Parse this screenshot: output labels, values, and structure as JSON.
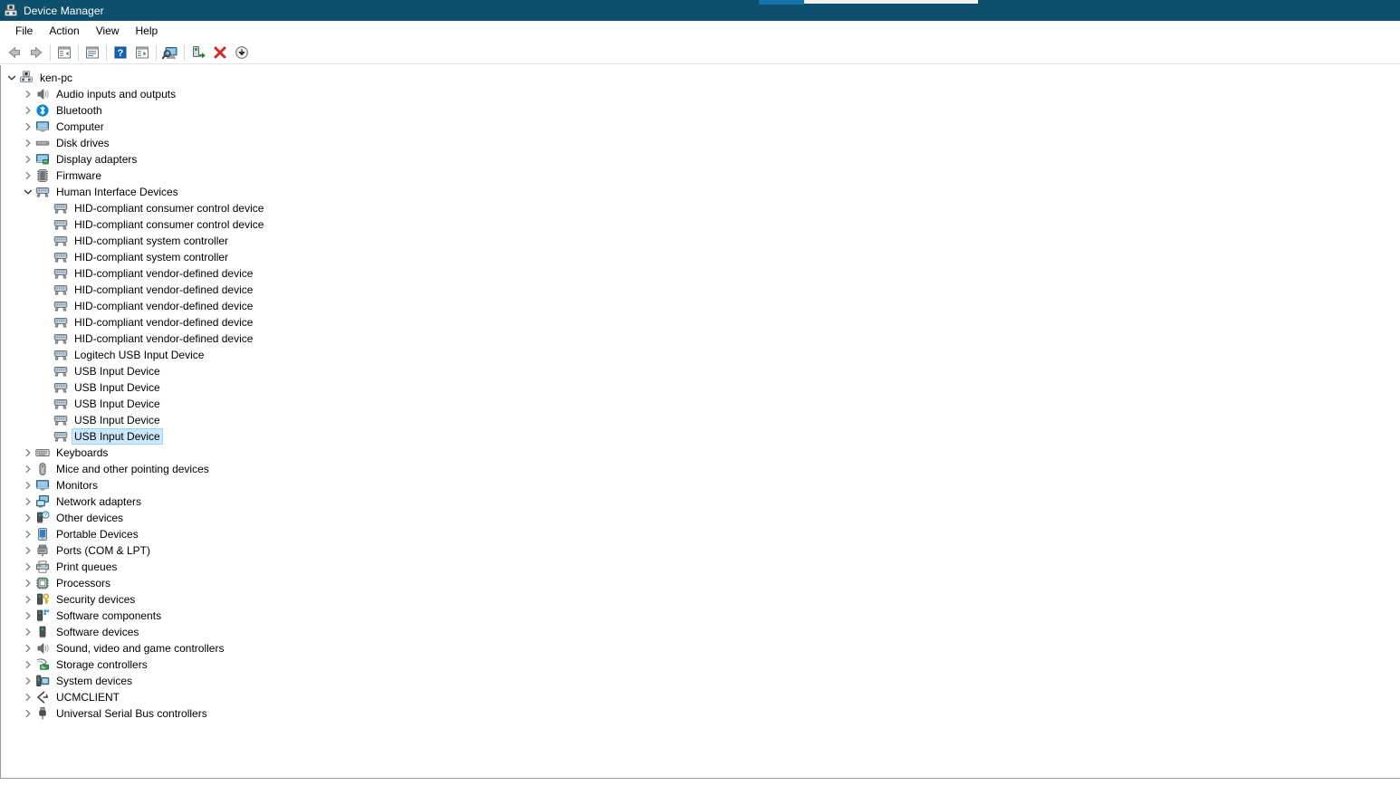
{
  "window": {
    "title": "Device Manager",
    "icon": "device-manager-icon",
    "titlebar_color": "#0d4f6c"
  },
  "record_strip": {
    "blue_color": "#1276a8",
    "white_color": "#f2f2f2"
  },
  "menubar": {
    "items": [
      {
        "label": "File"
      },
      {
        "label": "Action"
      },
      {
        "label": "View"
      },
      {
        "label": "Help"
      }
    ]
  },
  "toolbar": {
    "buttons": [
      {
        "name": "back-button",
        "icon": "back-arrow-icon"
      },
      {
        "name": "forward-button",
        "icon": "forward-arrow-icon"
      },
      {
        "name": "separator-1",
        "icon": "separator"
      },
      {
        "name": "show-hide-console-tree-button",
        "icon": "console-tree-icon"
      },
      {
        "name": "separator-2",
        "icon": "separator"
      },
      {
        "name": "properties-button",
        "icon": "properties-icon"
      },
      {
        "name": "separator-3",
        "icon": "separator"
      },
      {
        "name": "help-button",
        "icon": "help-question-icon"
      },
      {
        "name": "update-driver-button",
        "icon": "update-driver-icon"
      },
      {
        "name": "separator-4",
        "icon": "separator"
      },
      {
        "name": "scan-for-hardware-changes-button",
        "icon": "scan-hardware-icon"
      },
      {
        "name": "separator-5",
        "icon": "separator"
      },
      {
        "name": "enable-device-button",
        "icon": "enable-device-icon"
      },
      {
        "name": "uninstall-device-button",
        "icon": "uninstall-red-x-icon"
      },
      {
        "name": "disable-device-button",
        "icon": "disable-device-icon"
      }
    ]
  },
  "tree": {
    "selection_bg": "#cce8ff",
    "selection_border": "#99d1ff",
    "nodes": [
      {
        "label": "ken-pc",
        "level": 0,
        "icon": "computer-root-icon",
        "expanded": true,
        "twisty": "down",
        "selected": false
      },
      {
        "label": "Audio inputs and outputs",
        "level": 1,
        "icon": "speaker-icon",
        "expanded": false,
        "twisty": "right",
        "selected": false
      },
      {
        "label": "Bluetooth",
        "level": 1,
        "icon": "bluetooth-icon",
        "expanded": false,
        "twisty": "right",
        "selected": false
      },
      {
        "label": "Computer",
        "level": 1,
        "icon": "monitor-icon",
        "expanded": false,
        "twisty": "right",
        "selected": false
      },
      {
        "label": "Disk drives",
        "level": 1,
        "icon": "disk-drive-icon",
        "expanded": false,
        "twisty": "right",
        "selected": false
      },
      {
        "label": "Display adapters",
        "level": 1,
        "icon": "display-adapter-icon",
        "expanded": false,
        "twisty": "right",
        "selected": false
      },
      {
        "label": "Firmware",
        "level": 1,
        "icon": "firmware-chip-icon",
        "expanded": false,
        "twisty": "right",
        "selected": false
      },
      {
        "label": "Human Interface Devices",
        "level": 1,
        "icon": "hid-icon",
        "expanded": true,
        "twisty": "down",
        "selected": false
      },
      {
        "label": "HID-compliant consumer control device",
        "level": 2,
        "icon": "hid-icon",
        "expanded": false,
        "twisty": "none",
        "selected": false
      },
      {
        "label": "HID-compliant consumer control device",
        "level": 2,
        "icon": "hid-icon",
        "expanded": false,
        "twisty": "none",
        "selected": false
      },
      {
        "label": "HID-compliant system controller",
        "level": 2,
        "icon": "hid-icon",
        "expanded": false,
        "twisty": "none",
        "selected": false
      },
      {
        "label": "HID-compliant system controller",
        "level": 2,
        "icon": "hid-icon",
        "expanded": false,
        "twisty": "none",
        "selected": false
      },
      {
        "label": "HID-compliant vendor-defined device",
        "level": 2,
        "icon": "hid-icon",
        "expanded": false,
        "twisty": "none",
        "selected": false
      },
      {
        "label": "HID-compliant vendor-defined device",
        "level": 2,
        "icon": "hid-icon",
        "expanded": false,
        "twisty": "none",
        "selected": false
      },
      {
        "label": "HID-compliant vendor-defined device",
        "level": 2,
        "icon": "hid-icon",
        "expanded": false,
        "twisty": "none",
        "selected": false
      },
      {
        "label": "HID-compliant vendor-defined device",
        "level": 2,
        "icon": "hid-icon",
        "expanded": false,
        "twisty": "none",
        "selected": false
      },
      {
        "label": "HID-compliant vendor-defined device",
        "level": 2,
        "icon": "hid-icon",
        "expanded": false,
        "twisty": "none",
        "selected": false
      },
      {
        "label": "Logitech USB Input Device",
        "level": 2,
        "icon": "hid-icon",
        "expanded": false,
        "twisty": "none",
        "selected": false
      },
      {
        "label": "USB Input Device",
        "level": 2,
        "icon": "hid-icon",
        "expanded": false,
        "twisty": "none",
        "selected": false
      },
      {
        "label": "USB Input Device",
        "level": 2,
        "icon": "hid-icon",
        "expanded": false,
        "twisty": "none",
        "selected": false
      },
      {
        "label": "USB Input Device",
        "level": 2,
        "icon": "hid-icon",
        "expanded": false,
        "twisty": "none",
        "selected": false
      },
      {
        "label": "USB Input Device",
        "level": 2,
        "icon": "hid-icon",
        "expanded": false,
        "twisty": "none",
        "selected": false
      },
      {
        "label": "USB Input Device",
        "level": 2,
        "icon": "hid-icon",
        "expanded": false,
        "twisty": "none",
        "selected": true
      },
      {
        "label": "Keyboards",
        "level": 1,
        "icon": "keyboard-icon",
        "expanded": false,
        "twisty": "right",
        "selected": false
      },
      {
        "label": "Mice and other pointing devices",
        "level": 1,
        "icon": "mouse-icon",
        "expanded": false,
        "twisty": "right",
        "selected": false
      },
      {
        "label": "Monitors",
        "level": 1,
        "icon": "monitor-icon",
        "expanded": false,
        "twisty": "right",
        "selected": false
      },
      {
        "label": "Network adapters",
        "level": 1,
        "icon": "network-adapter-icon",
        "expanded": false,
        "twisty": "right",
        "selected": false
      },
      {
        "label": "Other devices",
        "level": 1,
        "icon": "other-device-question-icon",
        "expanded": false,
        "twisty": "right",
        "selected": false
      },
      {
        "label": "Portable Devices",
        "level": 1,
        "icon": "portable-device-icon",
        "expanded": false,
        "twisty": "right",
        "selected": false
      },
      {
        "label": "Ports (COM & LPT)",
        "level": 1,
        "icon": "port-connector-icon",
        "expanded": false,
        "twisty": "right",
        "selected": false
      },
      {
        "label": "Print queues",
        "level": 1,
        "icon": "printer-icon",
        "expanded": false,
        "twisty": "right",
        "selected": false
      },
      {
        "label": "Processors",
        "level": 1,
        "icon": "processor-icon",
        "expanded": false,
        "twisty": "right",
        "selected": false
      },
      {
        "label": "Security devices",
        "level": 1,
        "icon": "security-key-icon",
        "expanded": false,
        "twisty": "right",
        "selected": false
      },
      {
        "label": "Software components",
        "level": 1,
        "icon": "software-component-icon",
        "expanded": false,
        "twisty": "right",
        "selected": false
      },
      {
        "label": "Software devices",
        "level": 1,
        "icon": "software-device-icon",
        "expanded": false,
        "twisty": "right",
        "selected": false
      },
      {
        "label": "Sound, video and game controllers",
        "level": 1,
        "icon": "speaker-icon",
        "expanded": false,
        "twisty": "right",
        "selected": false
      },
      {
        "label": "Storage controllers",
        "level": 1,
        "icon": "storage-controller-icon",
        "expanded": false,
        "twisty": "right",
        "selected": false
      },
      {
        "label": "System devices",
        "level": 1,
        "icon": "system-device-icon",
        "expanded": false,
        "twisty": "right",
        "selected": false
      },
      {
        "label": "UCMCLIENT",
        "level": 1,
        "icon": "ucmclient-icon",
        "expanded": false,
        "twisty": "right",
        "selected": false
      },
      {
        "label": "Universal Serial Bus controllers",
        "level": 1,
        "icon": "usb-icon",
        "expanded": false,
        "twisty": "right",
        "selected": false
      }
    ]
  }
}
